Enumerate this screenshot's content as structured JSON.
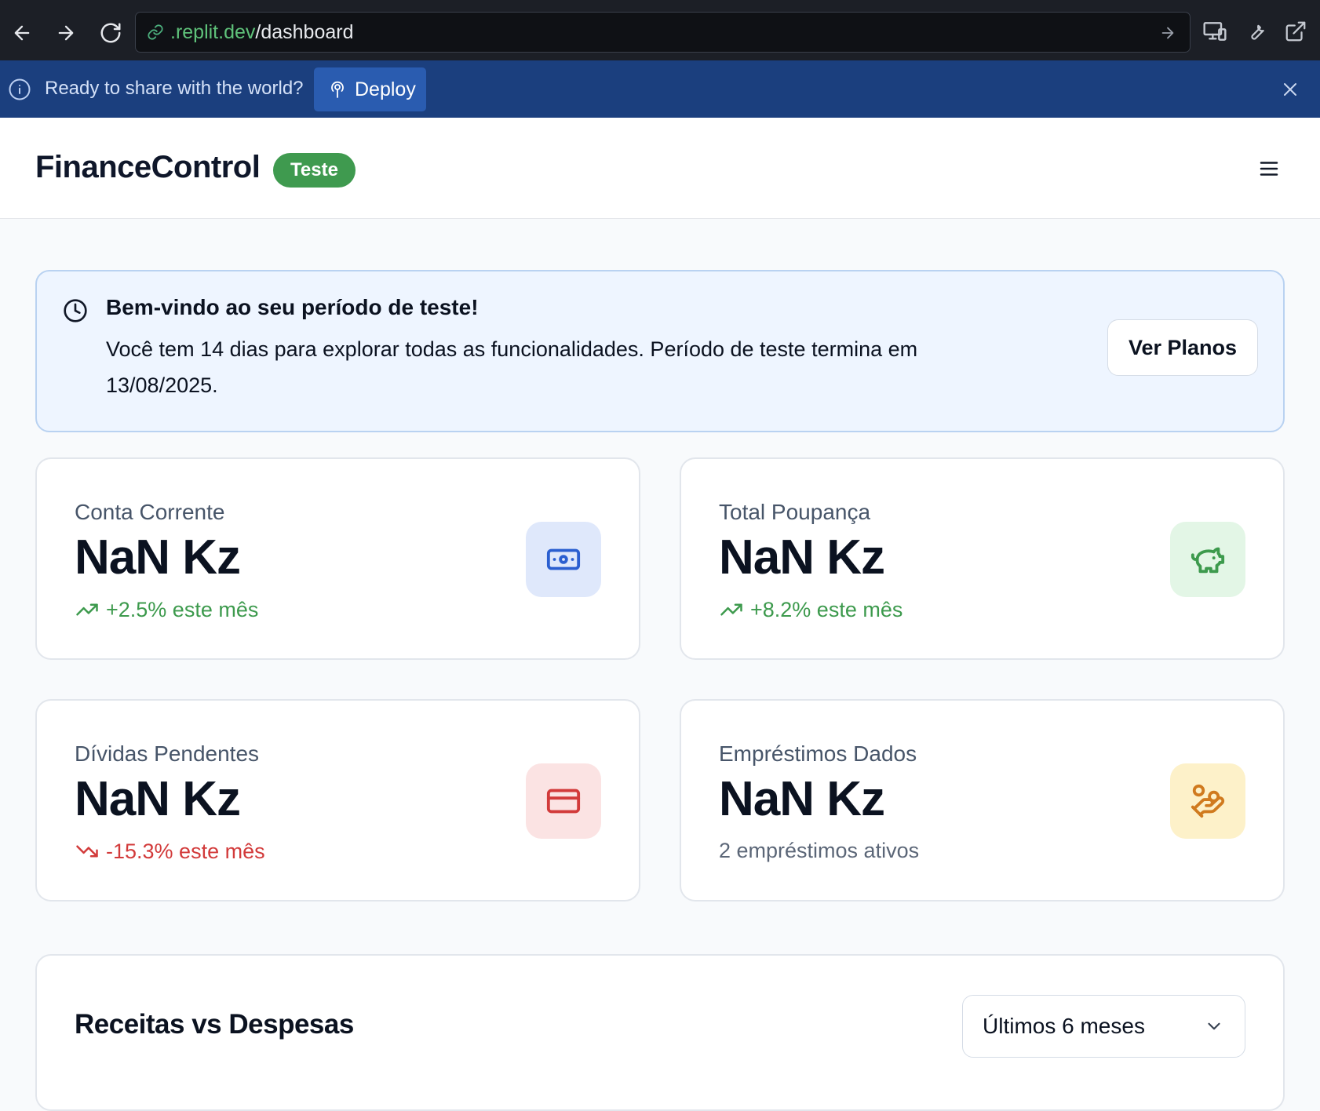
{
  "browser": {
    "url_domain": ".replit.dev",
    "url_path": "/dashboard"
  },
  "deploy_banner": {
    "message": "Ready to share with the world?",
    "button_label": "Deploy"
  },
  "header": {
    "brand": "FinanceControl",
    "badge": "Teste"
  },
  "trial_notice": {
    "title": "Bem-vindo ao seu período de teste!",
    "body": "Você tem 14 dias para explorar todas as funcionalidades. Período de teste termina em 13/08/2025.",
    "button_label": "Ver Planos"
  },
  "stats": [
    {
      "label": "Conta Corrente",
      "value": "NaN Kz",
      "trend": "+2.5% este mês",
      "trend_direction": "up",
      "icon": "banknote-icon",
      "icon_color": "#2b5fd0",
      "icon_bg": "#dfe8fb"
    },
    {
      "label": "Total Poupança",
      "value": "NaN Kz",
      "trend": "+8.2% este mês",
      "trend_direction": "up",
      "icon": "piggy-bank-icon",
      "icon_color": "#3d9a4d",
      "icon_bg": "#e3f6e6"
    },
    {
      "label": "Dívidas Pendentes",
      "value": "NaN Kz",
      "trend": "-15.3% este mês",
      "trend_direction": "down",
      "icon": "credit-card-icon",
      "icon_color": "#d23a3a",
      "icon_bg": "#fbe3e3"
    },
    {
      "label": "Empréstimos Dados",
      "value": "NaN Kz",
      "trend": "2 empréstimos ativos",
      "trend_direction": "neutral",
      "icon": "hand-coins-icon",
      "icon_color": "#d07a1e",
      "icon_bg": "#fdf1c9"
    }
  ],
  "chart_section": {
    "title": "Receitas vs Despesas",
    "period_selected": "Últimos 6 meses"
  }
}
